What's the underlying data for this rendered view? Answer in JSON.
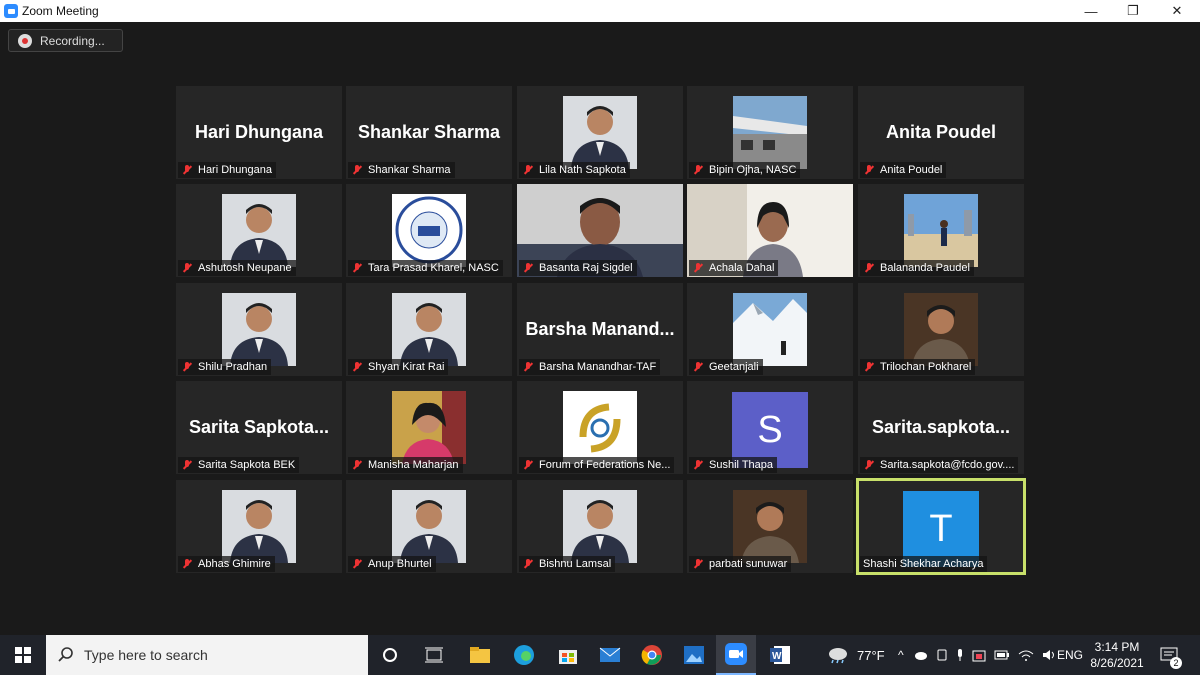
{
  "window": {
    "title": "Zoom Meeting",
    "minimize": "—",
    "maximize": "❐",
    "close": "✕"
  },
  "recording": {
    "label": "Recording..."
  },
  "participants": [
    {
      "name": "Hari Dhungana",
      "big": "Hari Dhungana"
    },
    {
      "name": "Shankar Sharma",
      "big": "Shankar Sharma"
    },
    {
      "name": "Lila Nath Sapkota",
      "video": "person"
    },
    {
      "name": "Bipin Ojha, NASC",
      "video": "building"
    },
    {
      "name": "Anita Poudel",
      "big": "Anita Poudel"
    },
    {
      "name": "Ashutosh Neupane",
      "video": "person"
    },
    {
      "name": "Tara Prasad Kharel, NASC",
      "video": "logo"
    },
    {
      "name": "Basanta Raj Sigdel",
      "video": "wide"
    },
    {
      "name": "Achala Dahal",
      "video": "wide"
    },
    {
      "name": "Balananda Paudel",
      "video": "outdoor"
    },
    {
      "name": "Shilu Pradhan",
      "video": "person"
    },
    {
      "name": "Shyan Kirat Rai",
      "video": "person"
    },
    {
      "name": "Barsha Manandhar-TAF",
      "big": "Barsha  Manand..."
    },
    {
      "name": "Geetanjali",
      "video": "snow"
    },
    {
      "name": "Trilochan Pokharel",
      "video": "person-dark"
    },
    {
      "name": "Sarita Sapkota BEK",
      "big": "Sarita  Sapkota..."
    },
    {
      "name": "Manisha Maharjan",
      "video": "person-yellow"
    },
    {
      "name": "Forum of Federations Ne...",
      "video": "fof-logo"
    },
    {
      "name": "Sushil Thapa",
      "avatar": "S",
      "avatar_color": "#5c5fc8"
    },
    {
      "name": "Sarita.sapkota@fcdo.gov....",
      "big": "Sarita.sapkota..."
    },
    {
      "name": "Abhas Ghimire",
      "video": "person"
    },
    {
      "name": "Anup Bhurtel",
      "video": "person"
    },
    {
      "name": "Bishnu Lamsal",
      "video": "person"
    },
    {
      "name": "parbati sunuwar",
      "video": "person-dark"
    },
    {
      "name": "Shashi Shekhar Acharya",
      "avatar": "T",
      "avatar_color": "#1f8fe0",
      "active": true,
      "muted": false
    }
  ],
  "taskbar": {
    "search_placeholder": "Type here to search",
    "weather": "77°F",
    "language": "ENG",
    "time": "3:14 PM",
    "date": "8/26/2021",
    "notifications": "2"
  },
  "colors": {
    "active_border": "#c8e06a",
    "mute_red": "#e33333",
    "tile_bg": "#262626"
  }
}
